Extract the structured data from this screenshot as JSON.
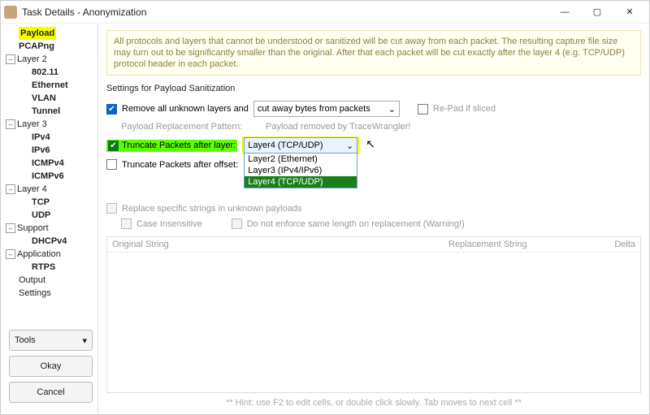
{
  "titlebar": {
    "title": "Task Details - Anonymization"
  },
  "sidebar": {
    "payload": "Payload",
    "pcapng": "PCAPng",
    "layer2": "Layer 2",
    "l80211": "802.11",
    "ethernet": "Ethernet",
    "vlan": "VLAN",
    "tunnel": "Tunnel",
    "layer3": "Layer 3",
    "ipv4": "IPv4",
    "ipv6": "IPv6",
    "icmpv4": "ICMPv4",
    "icmpv6": "ICMPv6",
    "layer4": "Layer 4",
    "tcp": "TCP",
    "udp": "UDP",
    "support": "Support",
    "dhcpv4": "DHCPv4",
    "application": "Application",
    "rtps": "RTPS",
    "output": "Output",
    "settings": "Settings"
  },
  "buttons": {
    "tools": "Tools",
    "okay": "Okay",
    "cancel": "Cancel"
  },
  "info": "All protocols and layers that cannot be understood or sanitized will be cut away from each packet. The resulting capture file size may turn out to be significantly smaller than the original. After that each packet will be cut exactly after the layer 4 (e.g. TCP/UDP) protocol header in each packet.",
  "section": {
    "heading": "Settings for Payload Sanitization"
  },
  "remove_unknown": {
    "label": "Remove all unknown layers and",
    "dd": "cut away bytes from packets",
    "repad": "Re-Pad if sliced"
  },
  "replacement": {
    "label": "Payload Replacement Pattern:",
    "value": "Payload removed by TraceWrangler!"
  },
  "truncate_layer": {
    "label": "Truncate Packets after layer:",
    "selected": "Layer4 (TCP/UDP)",
    "opts": [
      "Layer2 (Ethernet)",
      "Layer3 (IPv4/IPv6)",
      "Layer4 (TCP/UDP)"
    ]
  },
  "truncate_offset": {
    "label": "Truncate Packets after offset:"
  },
  "replace_strings": {
    "enable": "Replace specific strings in unknown payloads",
    "case": "Case Insensitive",
    "noenforce": "Do not enforce same length on replacement (Warning!)"
  },
  "table": {
    "c1": "Original String",
    "c2": "Replacement String",
    "c3": "Delta"
  },
  "hint": "** Hint: use F2 to edit cells, or double click slowly. Tab moves to next cell **"
}
